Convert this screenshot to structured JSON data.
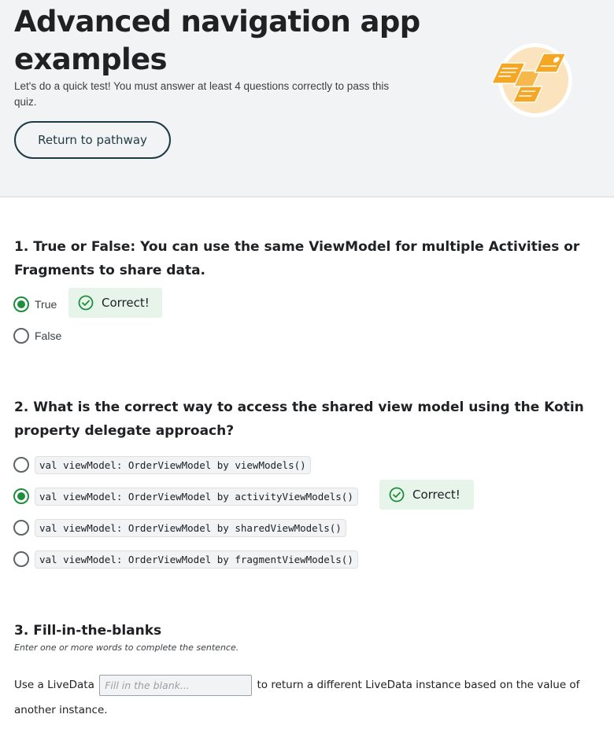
{
  "header": {
    "title": "Advanced navigation app examples",
    "description": "Let's do a quick test! You must answer at least 4 questions correctly to pass this quiz.",
    "return_button": "Return to pathway",
    "illustration_icon": "documents-illustration-icon"
  },
  "colors": {
    "correct_green": "#1e8e3e",
    "correct_bg": "#e6f4ea",
    "button_border": "#1e3a45",
    "hero_bg": "#f1f3f4",
    "illustration_orange": "#f5a623"
  },
  "questions": [
    {
      "title": "1. True or False: You can use the same ViewModel for multiple Activities or Fragments to share data.",
      "options": [
        {
          "label": "True",
          "selected": true
        },
        {
          "label": "False",
          "selected": false
        }
      ],
      "feedback": "Correct!"
    },
    {
      "title": "2. What is the correct way to access the shared view model using the Kotin property delegate approach?",
      "options": [
        {
          "label": "val viewModel: OrderViewModel by viewModels()",
          "selected": false
        },
        {
          "label": "val viewModel: OrderViewModel by activityViewModels()",
          "selected": true
        },
        {
          "label": "val viewModel: OrderViewModel by sharedViewModels()",
          "selected": false
        },
        {
          "label": "val viewModel: OrderViewModel by fragmentViewModels()",
          "selected": false
        }
      ],
      "feedback": "Correct!"
    },
    {
      "title": "3. Fill-in-the-blanks",
      "hint": "Enter one or more words to complete the sentence.",
      "text_before": "Use a LiveData",
      "input_value": "",
      "input_placeholder": "Fill in the blank...",
      "text_after": "to return a different LiveData instance based on the value of another instance."
    }
  ]
}
